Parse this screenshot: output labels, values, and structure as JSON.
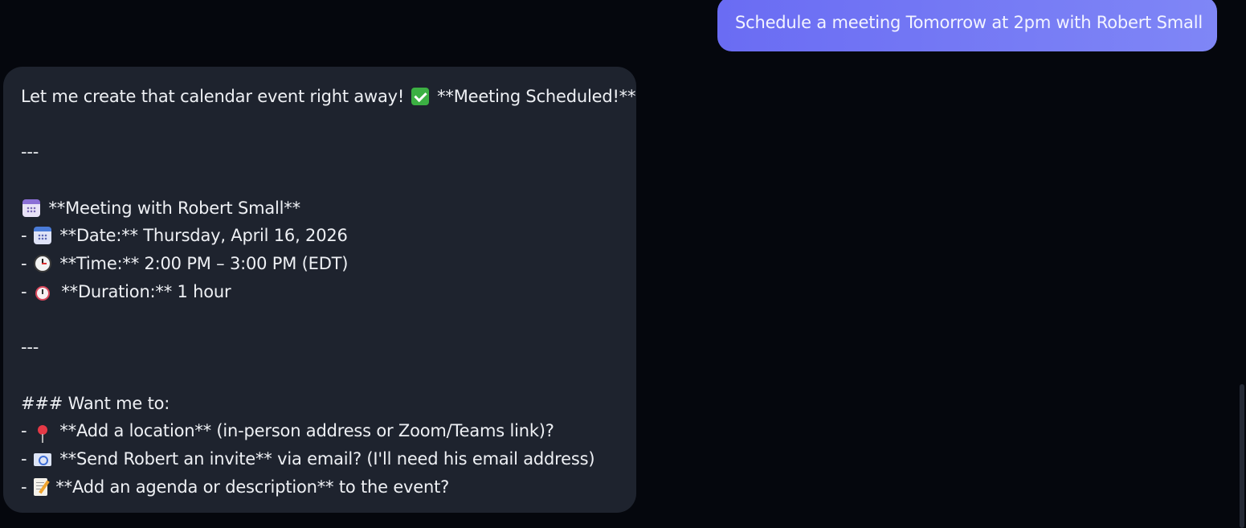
{
  "messages": {
    "user": {
      "text": "Schedule a meeting Tomorrow at 2pm with Robert Small"
    },
    "assistant": {
      "intro": "Let me create that calendar event right away!",
      "intro_suffix": "**Meeting Scheduled!**",
      "divider1": "---",
      "meeting_title": "**Meeting with Robert Small**",
      "date_prefix": "- ",
      "date": "**Date:** Thursday, April 16, 2026",
      "time_prefix": "- ",
      "time": "**Time:** 2:00 PM – 3:00 PM (EDT)",
      "duration_prefix": "- ",
      "duration": "**Duration:** 1 hour",
      "divider2": "---",
      "followup_heading": "### Want me to:",
      "option1_prefix": "- ",
      "option1": "**Add a location** (in-person address or Zoom/Teams link)?",
      "option2_prefix": "- ",
      "option2": "**Send Robert an invite** via email? (I'll need his email address)",
      "option3_prefix": "- ",
      "option3": "**Add an agenda or description** to the event?"
    }
  },
  "icons": {
    "intro_icon": "check-mark-button-icon",
    "meeting_icon": "calendar-icon",
    "date_icon": "spiral-calendar-icon",
    "time_icon": "clock-icon",
    "duration_icon": "alarm-clock-icon",
    "option1_icon": "round-pushpin-icon",
    "option2_icon": "envelope-icon",
    "option3_icon": "memo-icon"
  },
  "colors": {
    "background": "#05070d",
    "user_bubble_start": "#6a6cf3",
    "user_bubble_end": "#7f86f6",
    "assistant_bubble": "#1e232e"
  }
}
